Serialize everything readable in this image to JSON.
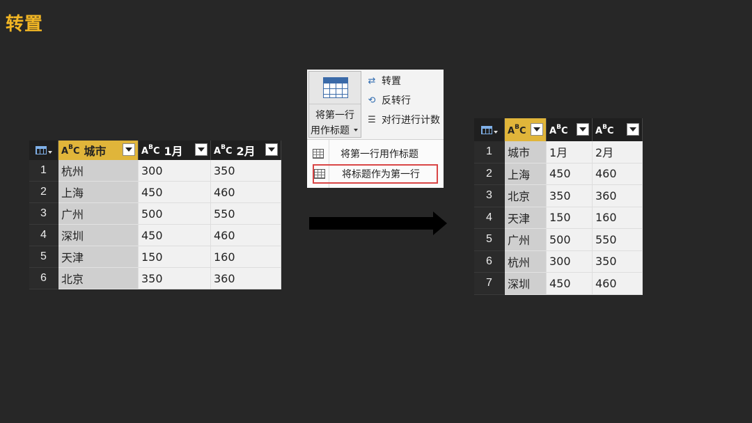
{
  "title": "转置",
  "left_table": {
    "headers": [
      {
        "type": "A",
        "type_sup": "B",
        "type_sub": "C",
        "label": "城市"
      },
      {
        "type": "A",
        "type_sup": "B",
        "type_sub": "C",
        "label": "1月"
      },
      {
        "type": "A",
        "type_sup": "B",
        "type_sub": "C",
        "label": "2月"
      }
    ],
    "rows": [
      {
        "idx": "1",
        "c1": "杭州",
        "c2": "300",
        "c3": "350"
      },
      {
        "idx": "2",
        "c1": "上海",
        "c2": "450",
        "c3": "460"
      },
      {
        "idx": "3",
        "c1": "广州",
        "c2": "500",
        "c3": "550"
      },
      {
        "idx": "4",
        "c1": "深圳",
        "c2": "450",
        "c3": "460"
      },
      {
        "idx": "5",
        "c1": "天津",
        "c2": "150",
        "c3": "160"
      },
      {
        "idx": "6",
        "c1": "北京",
        "c2": "350",
        "c3": "360"
      }
    ]
  },
  "ribbon": {
    "big_button_line1": "将第一行",
    "big_button_line2": "用作标题",
    "transpose": "转置",
    "reverse_rows": "反转行",
    "count_rows": "对行进行计数",
    "menu_use_first_row": "将第一行用作标题",
    "menu_headers_as_first_row": "将标题作为第一行"
  },
  "right_table": {
    "headers": [
      {
        "type": "A",
        "type_sup": "B",
        "type_sub": "C",
        "label": ""
      },
      {
        "type": "A",
        "type_sup": "B",
        "type_sub": "C",
        "label": ""
      },
      {
        "type": "A",
        "type_sup": "B",
        "type_sub": "C",
        "label": ""
      }
    ],
    "rows": [
      {
        "idx": "1",
        "c1": "城市",
        "c2": "1月",
        "c3": "2月"
      },
      {
        "idx": "2",
        "c1": "上海",
        "c2": "450",
        "c3": "460"
      },
      {
        "idx": "3",
        "c1": "北京",
        "c2": "350",
        "c3": "360"
      },
      {
        "idx": "4",
        "c1": "天津",
        "c2": "150",
        "c3": "160"
      },
      {
        "idx": "5",
        "c1": "广州",
        "c2": "500",
        "c3": "550"
      },
      {
        "idx": "6",
        "c1": "杭州",
        "c2": "300",
        "c3": "350"
      },
      {
        "idx": "7",
        "c1": "深圳",
        "c2": "450",
        "c3": "460"
      }
    ]
  },
  "colors": {
    "background": "#272727",
    "title": "#f2b624",
    "selected_header": "#e0b53a",
    "highlight_border": "#d94545"
  }
}
